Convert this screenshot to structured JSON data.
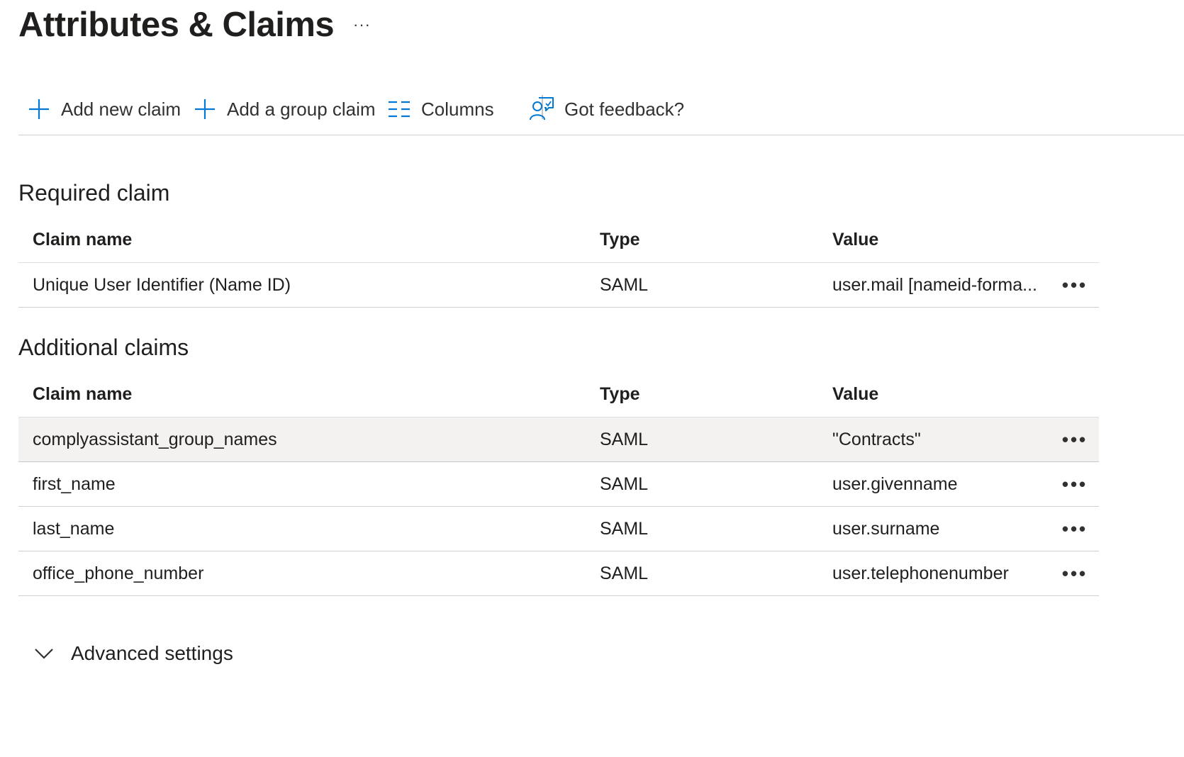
{
  "page": {
    "title": "Attributes & Claims",
    "more_label": "···"
  },
  "toolbar": {
    "add_claim_label": "Add new claim",
    "add_group_claim_label": "Add a group claim",
    "columns_label": "Columns",
    "feedback_label": "Got feedback?"
  },
  "required_section": {
    "title": "Required claim",
    "headers": {
      "name": "Claim name",
      "type": "Type",
      "value": "Value"
    },
    "rows": [
      {
        "name": "Unique User Identifier (Name ID)",
        "type": "SAML",
        "value": "user.mail [nameid-forma...",
        "more": "•••"
      }
    ]
  },
  "additional_section": {
    "title": "Additional claims",
    "headers": {
      "name": "Claim name",
      "type": "Type",
      "value": "Value"
    },
    "rows": [
      {
        "name": "complyassistant_group_names",
        "type": "SAML",
        "value": "\"Contracts\"",
        "more": "•••",
        "selected": true
      },
      {
        "name": "first_name",
        "type": "SAML",
        "value": "user.givenname",
        "more": "•••"
      },
      {
        "name": "last_name",
        "type": "SAML",
        "value": "user.surname",
        "more": "•••"
      },
      {
        "name": "office_phone_number",
        "type": "SAML",
        "value": "user.telephonenumber",
        "more": "•••"
      }
    ]
  },
  "advanced": {
    "label": "Advanced settings",
    "icon": "chevron-down-icon"
  },
  "colors": {
    "accent": "#0078d4",
    "selected_row": "#f3f2f1",
    "divider": "#d2d0ce"
  }
}
